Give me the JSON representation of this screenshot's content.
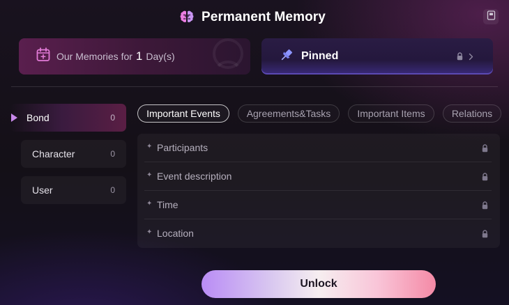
{
  "header": {
    "title": "Permanent Memory",
    "icon": "brain-icon",
    "action_icon": "book-icon"
  },
  "memories": {
    "prefix": "Our Memories for",
    "count": "1",
    "suffix": "Day(s)",
    "icon": "calendar-icon",
    "accent": "#e27bd7"
  },
  "pinned": {
    "label": "Pinned",
    "icon": "pushpin-icon",
    "lock_icon": "lock-icon",
    "chevron_icon": "chevron-right-icon"
  },
  "sidebar": {
    "items": [
      {
        "label": "Bond",
        "count": "0",
        "active": true
      },
      {
        "label": "Character",
        "count": "0",
        "active": false
      },
      {
        "label": "User",
        "count": "0",
        "active": false
      }
    ]
  },
  "tabs": [
    {
      "label": "Important Events",
      "active": true
    },
    {
      "label": "Agreements&Tasks",
      "active": false
    },
    {
      "label": "Important Items",
      "active": false
    },
    {
      "label": "Relations",
      "active": false
    }
  ],
  "fields": [
    {
      "label": "Participants"
    },
    {
      "label": "Event description"
    },
    {
      "label": "Time"
    },
    {
      "label": "Location"
    }
  ],
  "unlock_button": {
    "label": "Unlock"
  },
  "colors": {
    "accent_pink": "#e27bd7",
    "accent_purple": "#b98cf5",
    "pin_blue": "#6b76e8"
  }
}
